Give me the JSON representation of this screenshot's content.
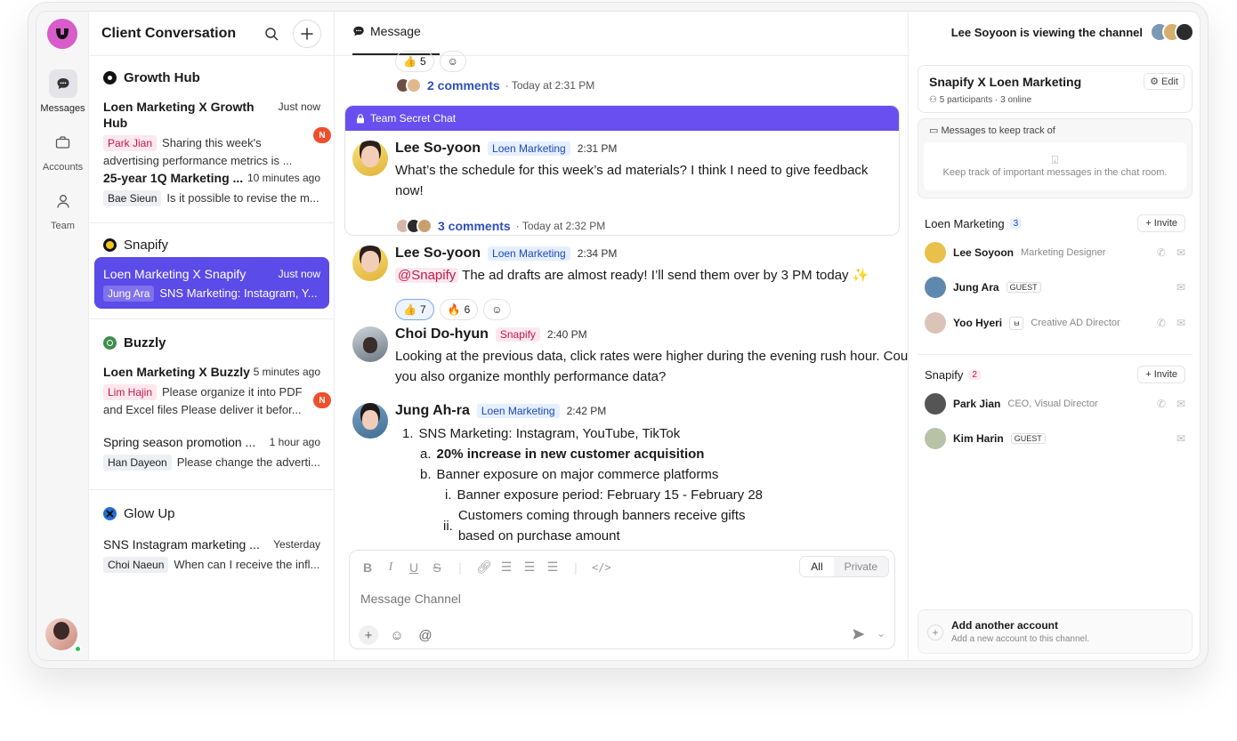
{
  "rail": {
    "items": [
      {
        "label": "Messages"
      },
      {
        "label": "Accounts"
      },
      {
        "label": "Team"
      }
    ]
  },
  "list": {
    "title": "Client Conversation",
    "groups": [
      {
        "name": "Growth Hub",
        "convs": [
          {
            "title": "Loen Marketing X Growth Hub",
            "time": "Just now",
            "sender": "Park Jian",
            "snippet": "Sharing this week's advertising performance metrics is ...",
            "badge": "N"
          },
          {
            "title": "25-year 1Q Marketing ...",
            "time": "10 minutes ago",
            "sender": "Bae Sieun",
            "snippet": "Is it possible to revise the m..."
          }
        ]
      },
      {
        "name": "Snapify",
        "convs": [
          {
            "title": "Loen Marketing X Snapify",
            "time": "Just now",
            "sender": "Jung Ara",
            "snippet": "SNS Marketing: Instagram, Y..."
          }
        ]
      },
      {
        "name": "Buzzly",
        "convs": [
          {
            "title": "Loen Marketing X Buzzly",
            "time": "5 minutes ago",
            "sender": "Lim Hajin",
            "snippet": "Please organize it into PDF and Excel files Please deliver it befor...",
            "badge": "N"
          },
          {
            "title": "Spring season promotion ...",
            "time": "1 hour ago",
            "sender": "Han Dayeon",
            "snippet": "Please change the adverti..."
          }
        ]
      },
      {
        "name": "Glow Up",
        "convs": [
          {
            "title": "SNS Instagram marketing ...",
            "time": "Yesterday",
            "sender": "Choi Naeun",
            "snippet": "When can I receive the infl..."
          }
        ]
      }
    ]
  },
  "chat": {
    "tab": "Message",
    "top_reactions": [
      {
        "emoji": "👍",
        "count": "5"
      }
    ],
    "top_comments": {
      "count": "2 comments",
      "time": "· Today at 2:31 PM"
    },
    "secret_label": "Team Secret Chat",
    "messages": [
      {
        "name": "Lee So-yoon",
        "chip": "Loen Marketing",
        "time": "2:31 PM",
        "text1": "What’s the schedule for this week’s ad materials? I think I need to give feedback",
        "text2": "now!",
        "comments": "3 comments",
        "ctime": "· Today at 2:32 PM"
      },
      {
        "name": "Lee So-yoon",
        "chip": "Loen Marketing",
        "time": "2:34 PM",
        "mention": "@Snapify",
        "text": "The ad drafts are almost ready! I’ll send them over by 3 PM today ✨",
        "reactions": [
          {
            "emoji": "👍",
            "count": "7"
          },
          {
            "emoji": "🔥",
            "count": "6"
          }
        ]
      },
      {
        "name": "Choi Do-hyun",
        "chip": "Snapify",
        "time": "2:40 PM",
        "text1": "Looking at the previous data, click rates were higher during the evening rush hour. Could",
        "text2": "you also organize monthly performance data?"
      },
      {
        "name": "Jung Ah-ra",
        "chip": "Loen Marketing",
        "time": "2:42 PM",
        "list": [
          {
            "marker": "1.",
            "text": "SNS Marketing: Instagram, YouTube, TikTok"
          },
          {
            "marker": "a.",
            "text": "20% increase in new customer acquisition"
          },
          {
            "marker": "b.",
            "text": "Banner exposure on major commerce platforms"
          },
          {
            "marker": "i.",
            "text": "Banner exposure period: February 15 - February 28"
          },
          {
            "marker": "ii.",
            "text1": "Customers coming through banners receive gifts",
            "text2": "based on purchase amount"
          }
        ]
      }
    ],
    "editor": {
      "placeholder": "Message Channel",
      "seg_all": "All",
      "seg_private": "Private"
    }
  },
  "right": {
    "viewing": "Lee Soyoon is viewing the channel",
    "channel_title": "Snapify X Loen Marketing",
    "channel_meta": "5 participants · 3 online",
    "edit": "Edit",
    "track_title": "Messages to keep track of",
    "track_empty": "Keep track of important messages in the chat room.",
    "sections": [
      {
        "name": "Loen Marketing",
        "count": "3",
        "invite": "+ Invite",
        "people": [
          {
            "name": "Lee Soyoon",
            "role": "Marketing Designer",
            "guest": "",
            "icon_tag": ""
          },
          {
            "name": "Jung Ara",
            "role": "",
            "guest": "GUEST",
            "icon_tag": ""
          },
          {
            "name": "Yoo Hyeri",
            "role": "Creative AD Director",
            "guest": "",
            "icon_tag": "ㅂ"
          }
        ]
      },
      {
        "name": "Snapify",
        "count": "2",
        "invite": "+ Invite",
        "people": [
          {
            "name": "Park Jian",
            "role": "CEO, Visual Director",
            "guest": ""
          },
          {
            "name": "Kim Harin",
            "role": "",
            "guest": "GUEST"
          }
        ]
      }
    ],
    "add_account": {
      "title": "Add another account",
      "subtitle": "Add a new account to this channel."
    }
  }
}
